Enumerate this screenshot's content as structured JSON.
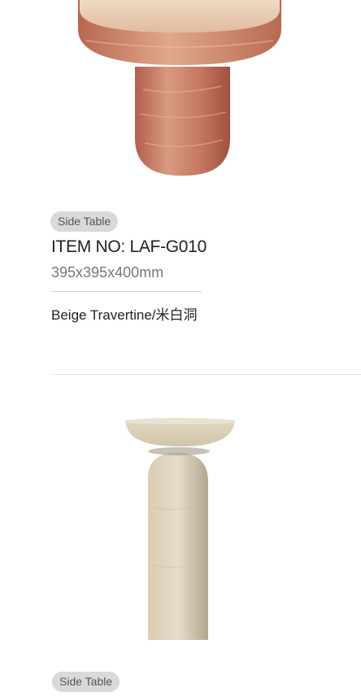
{
  "products": [
    {
      "image": {
        "icon": "travertine-side-table-image",
        "color": "#c9826a"
      },
      "category": "Side Table",
      "item_no": "ITEM NO:  LAF-G010",
      "dimensions": "395x395x400mm",
      "material": "Beige Travertine/米白洞"
    },
    {
      "image": {
        "icon": "beige-travertine-pedestal-table-image",
        "color": "#d8ccb4"
      },
      "category": "Side Table"
    }
  ]
}
